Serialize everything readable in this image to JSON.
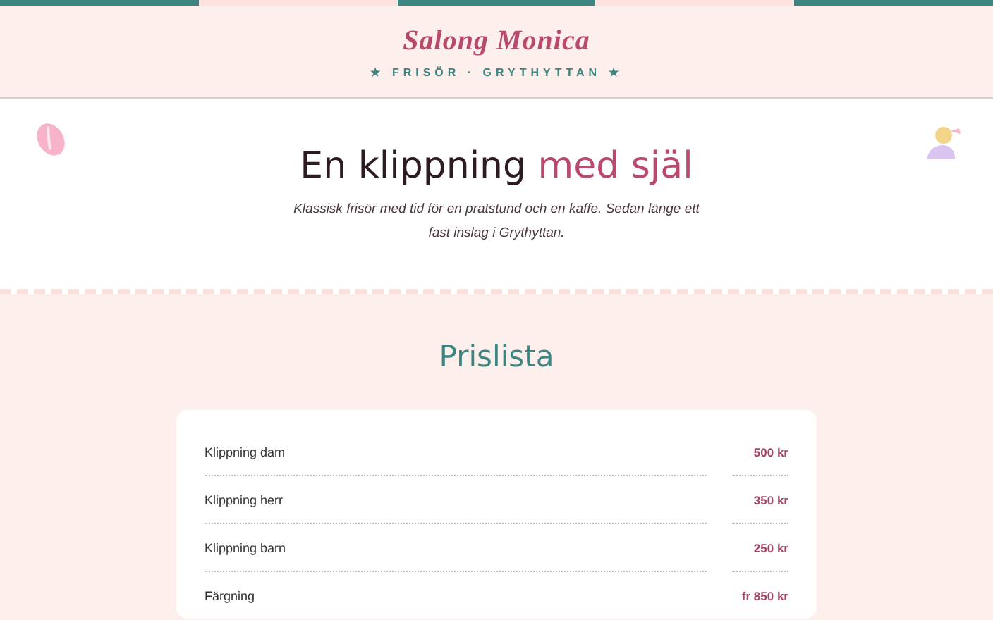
{
  "header": {
    "title": "Salong Monica",
    "tagline": "★ FRISÖR · GRYTHYTTAN ★"
  },
  "hero": {
    "heading": "En klippning",
    "heading_accent": "med själ",
    "intro": "Klassisk frisör med tid för en pratstund och en kaffe. Sedan länge ett fast inslag i Grythyttan."
  },
  "prices": {
    "title": "Prislista",
    "rows": [
      {
        "service": "Klippning dam",
        "price": "500 kr"
      },
      {
        "service": "Klippning herr",
        "price": "350 kr"
      },
      {
        "service": "Klippning barn",
        "price": "250 kr"
      },
      {
        "service": "Färgning",
        "price": "fr 850 kr"
      }
    ]
  }
}
